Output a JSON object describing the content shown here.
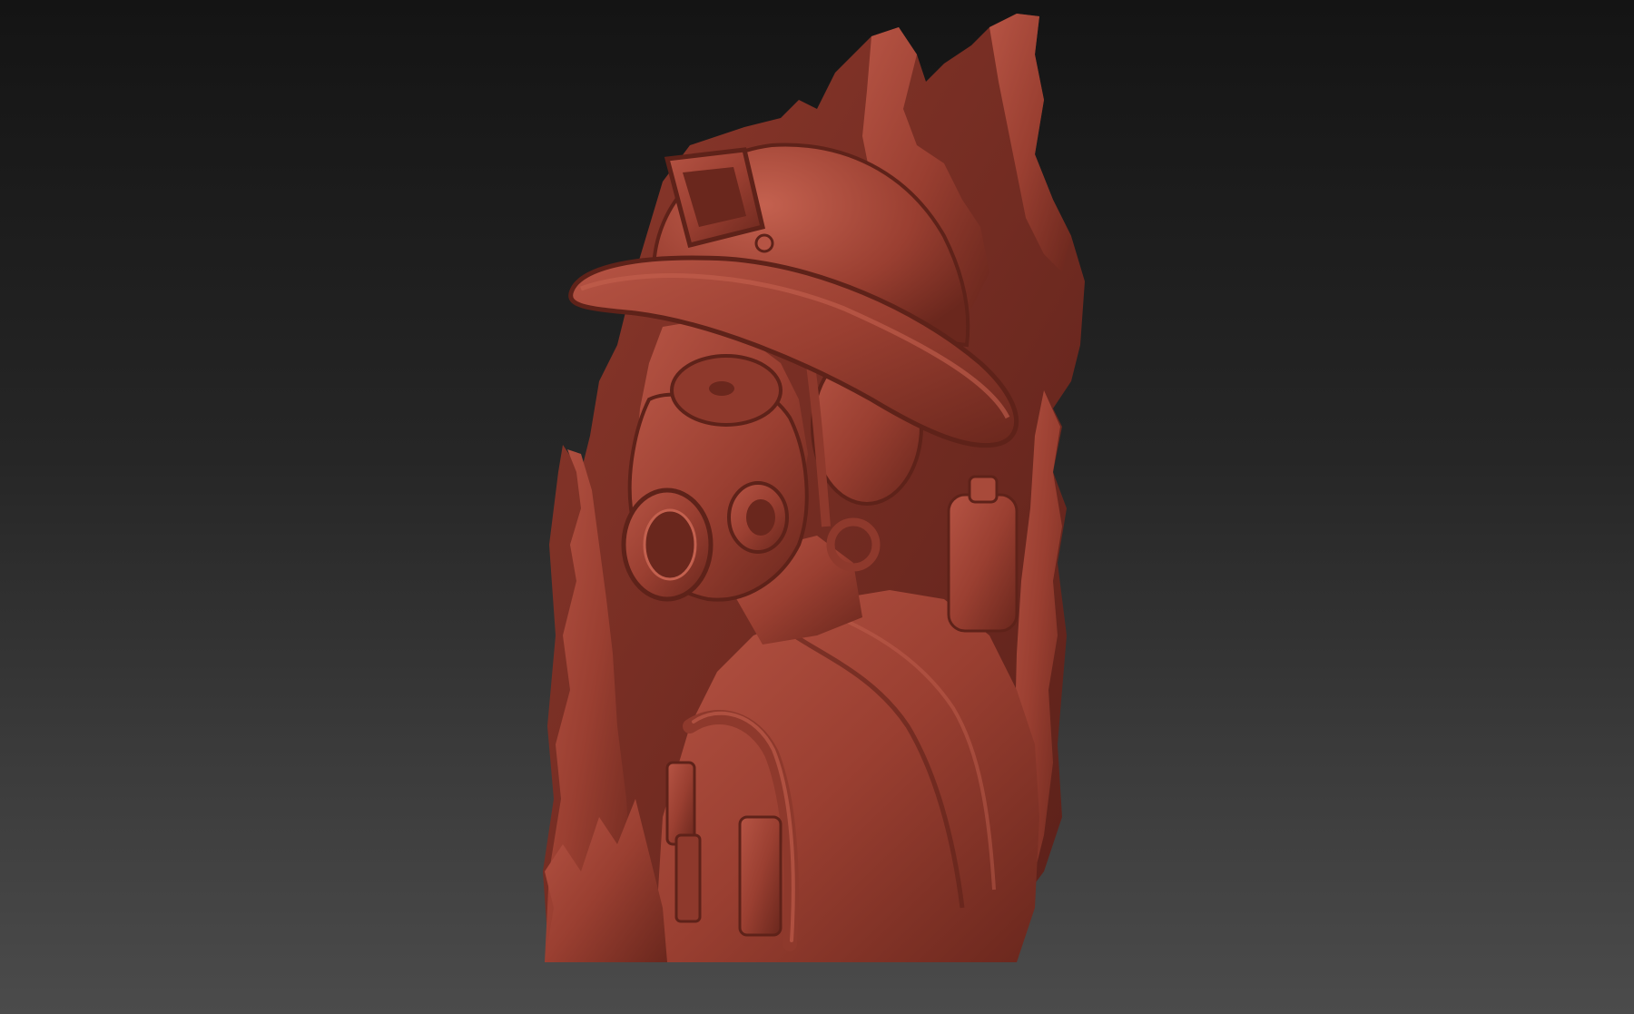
{
  "viewport": {
    "background_top": "#141414",
    "background_bottom": "#4b4b4b"
  },
  "model": {
    "subject": "firefighter-relief-sculpture",
    "material_color": "#9a3f31",
    "shadow_color": "#5e2219",
    "highlight_color": "#c4614f"
  }
}
